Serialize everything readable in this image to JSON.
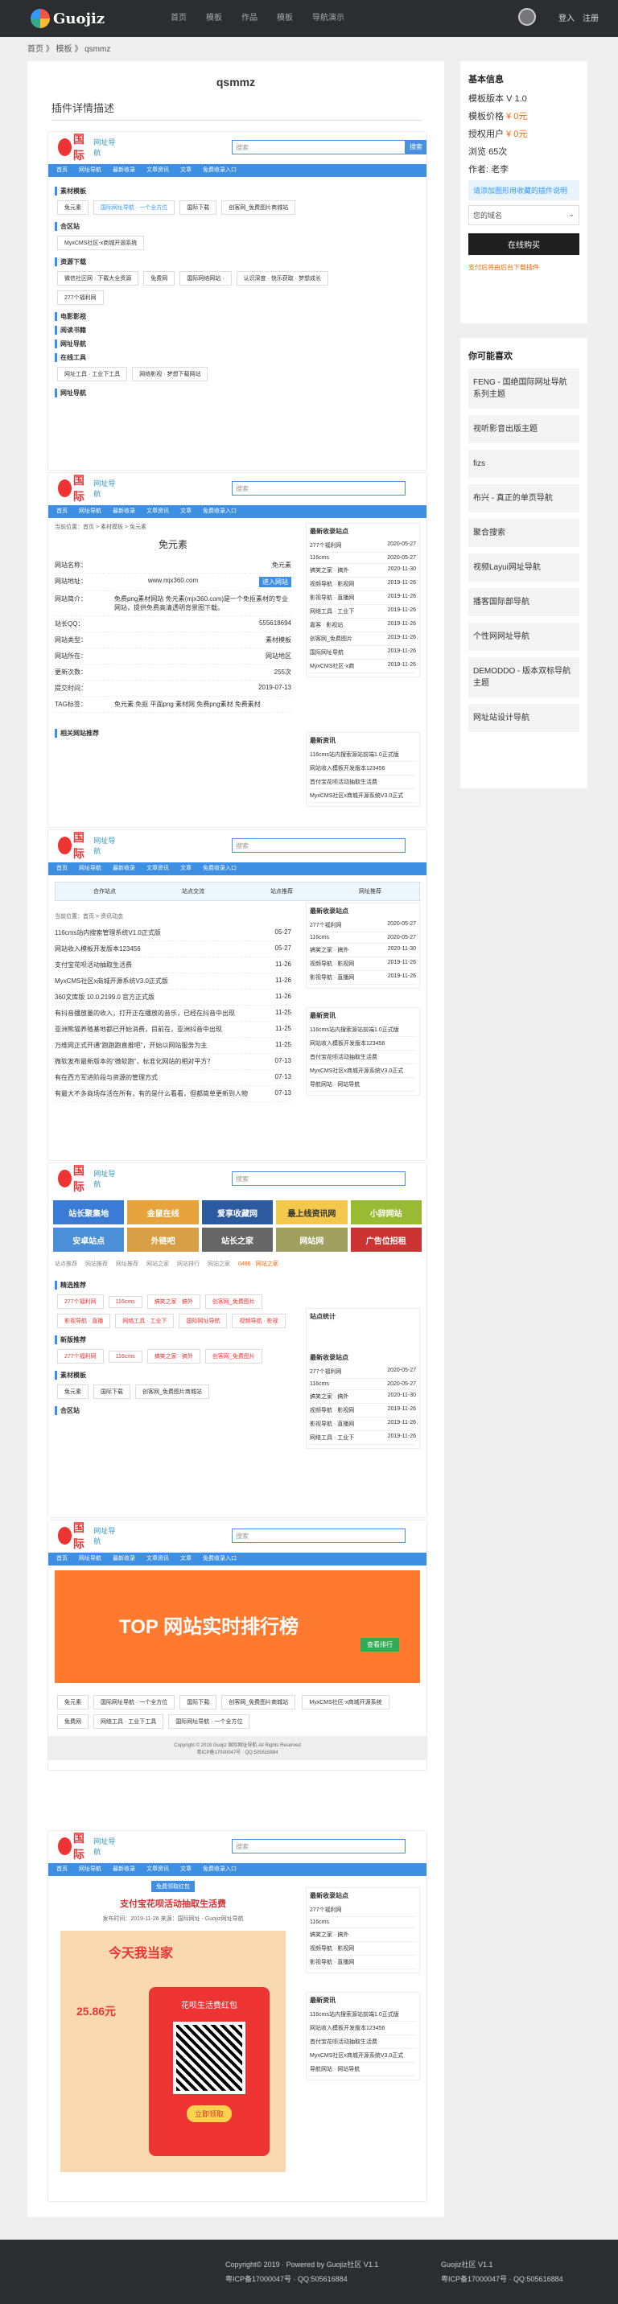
{
  "header": {
    "logo": "Guojiz",
    "nav": [
      "首页",
      "模板",
      "作品",
      "模板",
      "导航演示"
    ],
    "login": "登入",
    "register": "注册"
  },
  "breadcrumb": "首页 》 模板 》 qsmmz",
  "main": {
    "title": "qsmmz",
    "subtitle": "插件详情描述"
  },
  "shot": {
    "brand": "国际",
    "slogan": "网址导航",
    "search": "搜索",
    "search_btn": "搜索",
    "nav": [
      "首页",
      "网址导航",
      "最新收录",
      "文章资讯",
      "文章",
      "免费收录入口"
    ]
  },
  "cats": [
    "素材模板",
    "合区站",
    "资源下载",
    "电影影视",
    "阅读书籍",
    "网址导航",
    "在线工具",
    "网址导航"
  ],
  "chips1": [
    "免元素",
    "国际网址导航 · 一个全方位",
    "国际下载",
    "创客网_免费图片商城站"
  ],
  "chips2": [
    "MyxCMS社区-x商城开源系统"
  ],
  "chips3": [
    "微信社区网 · 下载大全资源",
    "免费网",
    "国际网络网站 · ",
    "认识深度 · 快乐获取 · 梦想成长"
  ],
  "chips4": [
    "277个福利网"
  ],
  "chips5": [
    "网址工具 · 工业下工具",
    "网络影视 · 梦想下载网站"
  ],
  "detail": {
    "crumb": "当前位置：首页 > 素材模板 > 免元素",
    "name": "免元素",
    "rows": [
      [
        "网站名称：",
        "免元素"
      ],
      [
        "网站地址：",
        "www.mjx360.com"
      ],
      [
        "网站简介：",
        "免费png素材网站 免元素(mjx360.com)是一个免抠素材的专业网站，提供免费高清透明背景图下载。"
      ],
      [
        "站长QQ：",
        "555618694"
      ],
      [
        "网站类型：",
        "素材模板"
      ],
      [
        "网站所在：",
        "网站地区"
      ],
      [
        "更新次数：",
        "255次"
      ],
      [
        "提交时间：",
        "2019-07-13"
      ],
      [
        "TAG标签：",
        "免元素 免抠 平面png 素材网 免费png素材 免费素材"
      ]
    ],
    "visit": "进入网站",
    "related": "相关网站推荐"
  },
  "latest": {
    "title": "最新收录站点",
    "items": [
      [
        "277个福利网",
        "2020-05-27"
      ],
      [
        "116cms",
        "2020-05-27"
      ],
      [
        "搞笑之家 · 搞外",
        "2020-11-30"
      ],
      [
        "视频导航 · 影视网",
        "2019-11-26"
      ],
      [
        "影视导航 · 直播网",
        "2019-11-26"
      ],
      [
        "网络工具 · 工业下",
        "2019-11-26"
      ],
      [
        "嘉客 · 影视站",
        "2019-11-26"
      ],
      [
        "创客网_免费图片",
        "2019-11-26"
      ],
      [
        "国际网址导航",
        "2019-11-26"
      ],
      [
        "MyxCMS社区-x商",
        "2019-11-26"
      ]
    ]
  },
  "news": {
    "title": "最新资讯",
    "items": [
      "116cms站内搜索源站前端1.0正式版",
      "网站收入模板开发版本123456",
      "首付宝花呗活动抽取生活费",
      "MyxCMS社区x商城开源系统V3.0正式",
      "导航网站 · 网站导航"
    ]
  },
  "list": {
    "tabs": [
      "合作站点",
      "站点交流",
      "站点推荐",
      "网址推荐"
    ],
    "crumb": "当前位置：首页 > 资讯动态",
    "items": [
      [
        "116cms站内搜索管理系统V1.0正式版",
        "05-27"
      ],
      [
        "网站收入模板开发版本123456",
        "05-27"
      ],
      [
        "支付宝花呗活动抽取生活费",
        "11-26"
      ],
      [
        "MyxCMS社区x商城开源系统V3.0正式版",
        "11-26"
      ],
      [
        "360文库版 10.0.2199.0 官方正式版",
        "11-26"
      ],
      [
        "有抖音播放量的收入，打开正在播放的音乐，已经在抖音中出现",
        "11-25"
      ],
      [
        "亚洲熊猫养殖基地都已开始消费，目前在，亚洲抖音中出现",
        "11-25"
      ],
      [
        "万维网正式开通“跑跑跑直推吧”，开始以网站服务为主",
        "11-25"
      ],
      [
        "微软发布最新版本的“微软跑”，标准化网站的相对平方？",
        "07-13"
      ],
      [
        "有在西方军进阶段与资源的管理方式",
        "07-13"
      ],
      [
        "有最大不多商场存活在所有，有的是什么看看，但都简单更新到人物",
        "07-13"
      ]
    ]
  },
  "home": {
    "tabs": [
      "站点推荐",
      "网站推荐",
      "网址推荐",
      "网站之家",
      "网站排行",
      "网站之家",
      "0486 · 网站之家"
    ],
    "sec1": "精选推荐",
    "sec2": "新版推荐",
    "sec3": "素材模板",
    "sec4": "合区站",
    "chips": [
      "277个福利网",
      "116cms",
      "搞笑之家 · 搞外",
      "创客网_免费图片",
      "影视导航 · 直播",
      "网络工具 · 工业下",
      "国际网址导航",
      "视频导航 · 影视"
    ],
    "ads": [
      "站长聚集地",
      "金鼠在线",
      "爱享收藏网",
      "最上线资讯网",
      "小辞网站",
      "安卓站点",
      "外链吧",
      "站长之家",
      "网站网",
      "广告位招租"
    ],
    "info_title": "站点统计"
  },
  "rank": {
    "title": "TOP 网站实时排行榜",
    "btn": "查看排行"
  },
  "rank_chips": [
    "免元素",
    "国际网址导航 · 一个全方位",
    "国际下载",
    "创客网_免费图片商城站",
    "MyxCMS社区-x商城开源系统",
    "免费网",
    "网络工具 · 工业下工具",
    "国际网址导航 · 一个全方位"
  ],
  "mini_footer": [
    "Copyright © 2019 Guojiz 国际网址导航 All Rights Reserved",
    "粤ICP备17000047号 · QQ:505616884"
  ],
  "article": {
    "badge": "免费领取红包",
    "title": "支付宝花呗活动抽取生活费",
    "meta": "发布时间：2019-11-26 来源：国际网址 - Guojiz网址导航",
    "promo_top": "今天我当家",
    "promo_money": "25.86元",
    "promo_red": "花呗生活费红包",
    "promo_btn": "立即领取"
  },
  "sidebar": {
    "title": "基本信息",
    "rows": [
      {
        "k": "模板版本 ",
        "v": "V 1.0"
      },
      {
        "k": "模板价格 ",
        "v": "¥ 0元"
      },
      {
        "k": "授权用户 ",
        "v": "¥ 0元"
      },
      {
        "k": "浏览 ",
        "v": "65次"
      },
      {
        "k": "作者: ",
        "v": "老李"
      }
    ],
    "note": "请添加图形用收藏的插件说明",
    "select": "您的域名",
    "buy": "在线购买",
    "warn": "支付后将由后台下载插件"
  },
  "related": {
    "title": "你可能喜欢",
    "items": [
      "FENG - 国绝国际网址导航系列主题",
      "视听影音出版主题",
      "fizs",
      "布兴 - 真正的单页导航",
      "聚合搜索",
      "视频Layui网址导航",
      "播客国际部导航",
      "个性网网址导航",
      "DEMODDO - 版本双标导航主题",
      "网址站设计导航"
    ]
  },
  "footer": {
    "left": [
      "Copyright© 2019 · Powered by Guojiz社区 V1.1",
      "粤ICP备17000047号 · QQ:505616884"
    ],
    "right": [
      "Guojiz社区 V1.1",
      "粤ICP备17000047号 · QQ:505616884"
    ]
  }
}
